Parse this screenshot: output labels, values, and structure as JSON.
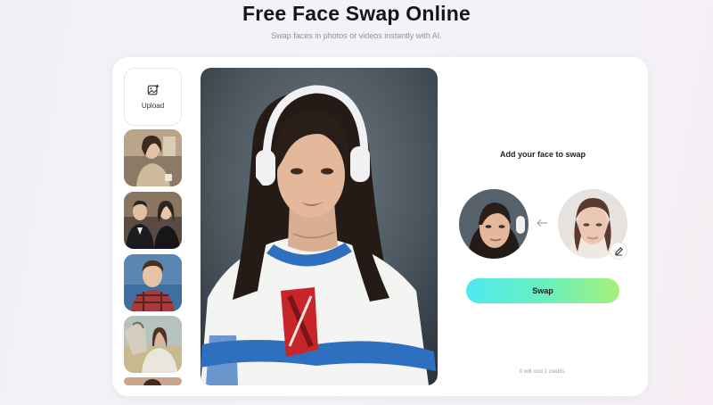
{
  "page": {
    "title": "Free Face Swap Online",
    "subtitle": "Swap faces in photos or videos instantly with AI."
  },
  "sidebar": {
    "upload_label": "Upload",
    "upload_icon": "image-add-icon",
    "thumbnails": [
      {
        "name": "thumbnail-woman-cafe"
      },
      {
        "name": "thumbnail-couple-formal"
      },
      {
        "name": "thumbnail-young-man-plaid"
      },
      {
        "name": "thumbnail-woman-with-horse"
      },
      {
        "name": "thumbnail-partial"
      }
    ]
  },
  "main": {
    "image": "target-photo-woman-headphones-jersey"
  },
  "swap_panel": {
    "heading": "Add your face to swap",
    "arrow_icon": "arrow-left-icon",
    "edit_icon": "pencil-icon",
    "swap_label": "Swap",
    "credits_note": "It will cost 1 credits."
  },
  "colors": {
    "swap_gradient_start": "#4fe9f2",
    "swap_gradient_end": "#a7f07a",
    "page_bg": "#f1f2f6"
  }
}
